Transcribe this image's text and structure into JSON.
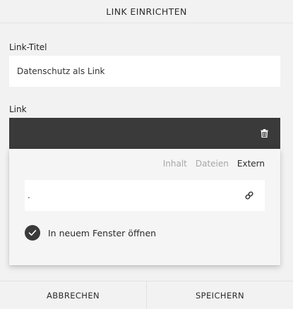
{
  "dialog": {
    "title": "LINK EINRICHTEN"
  },
  "link_title": {
    "label": "Link-Titel",
    "value": "Datenschutz als Link"
  },
  "link": {
    "label": "Link",
    "bar_color": "#3a3a3a",
    "trash_icon": "trash-icon",
    "tabs": [
      {
        "label": "Inhalt",
        "active": false
      },
      {
        "label": "Dateien",
        "active": false
      },
      {
        "label": "Extern",
        "active": true
      }
    ],
    "url_value": ".",
    "url_icon": "link-icon",
    "new_window": {
      "label": "In neuem Fenster öffnen",
      "checked": true
    }
  },
  "footer": {
    "cancel_label": "ABBRECHEN",
    "save_label": "SPEICHERN"
  }
}
